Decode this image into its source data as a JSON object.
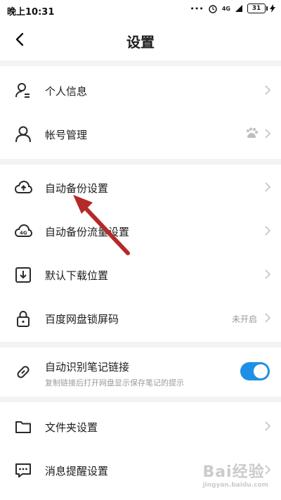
{
  "status_bar": {
    "time": "晚上10:31",
    "network": "4G",
    "battery": "31"
  },
  "header": {
    "title": "设置"
  },
  "rows": [
    {
      "label": "个人信息"
    },
    {
      "label": "帐号管理"
    },
    {
      "label": "自动备份设置"
    },
    {
      "label": "自动备份流量设置"
    },
    {
      "label": "默认下载位置"
    },
    {
      "label": "百度网盘锁屏码",
      "status": "未开启"
    },
    {
      "label": "自动识别笔记链接",
      "sub": "复制链接后打开网盘显示保存笔记的提示",
      "toggle": true
    },
    {
      "label": "文件夹设置"
    },
    {
      "label": "消息提醒设置"
    }
  ],
  "accent": "#1e8fe6",
  "watermark": {
    "text": "Bai经验",
    "url": "jingyan.baidu.com"
  }
}
